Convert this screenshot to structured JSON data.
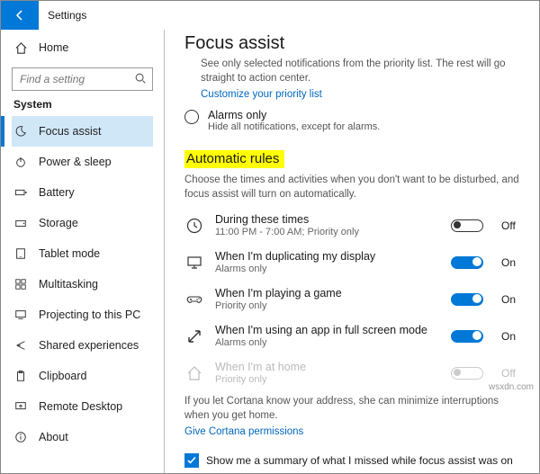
{
  "title": "Settings",
  "sidebar": {
    "home": "Home",
    "search_placeholder": "Find a setting",
    "section": "System",
    "items": [
      {
        "label": "Focus assist"
      },
      {
        "label": "Power & sleep"
      },
      {
        "label": "Battery"
      },
      {
        "label": "Storage"
      },
      {
        "label": "Tablet mode"
      },
      {
        "label": "Multitasking"
      },
      {
        "label": "Projecting to this PC"
      },
      {
        "label": "Shared experiences"
      },
      {
        "label": "Clipboard"
      },
      {
        "label": "Remote Desktop"
      },
      {
        "label": "About"
      }
    ]
  },
  "main": {
    "heading": "Focus assist",
    "priority_desc": "See only selected notifications from the priority list. The rest will go straight to action center.",
    "priority_link": "Customize your priority list",
    "alarms_label": "Alarms only",
    "alarms_desc": "Hide all notifications, except for alarms.",
    "auto_heading": "Automatic rules",
    "auto_desc": "Choose the times and activities when you don't want to be disturbed, and focus assist will turn on automatically.",
    "rules": [
      {
        "label": "During these times",
        "sub": "11:00 PM - 7:00 AM; Priority only",
        "state": "Off"
      },
      {
        "label": "When I'm duplicating my display",
        "sub": "Alarms only",
        "state": "On"
      },
      {
        "label": "When I'm playing a game",
        "sub": "Priority only",
        "state": "On"
      },
      {
        "label": "When I'm using an app in full screen mode",
        "sub": "Alarms only",
        "state": "On"
      },
      {
        "label": "When I'm at home",
        "sub": "Priority only",
        "state": "Off"
      }
    ],
    "cortana_msg": "If you let Cortana know your address, she can minimize interruptions when you get home.",
    "cortana_link": "Give Cortana permissions",
    "summary_checkbox": "Show me a summary of what I missed while focus assist was on"
  },
  "watermark": "wsxdn.com"
}
